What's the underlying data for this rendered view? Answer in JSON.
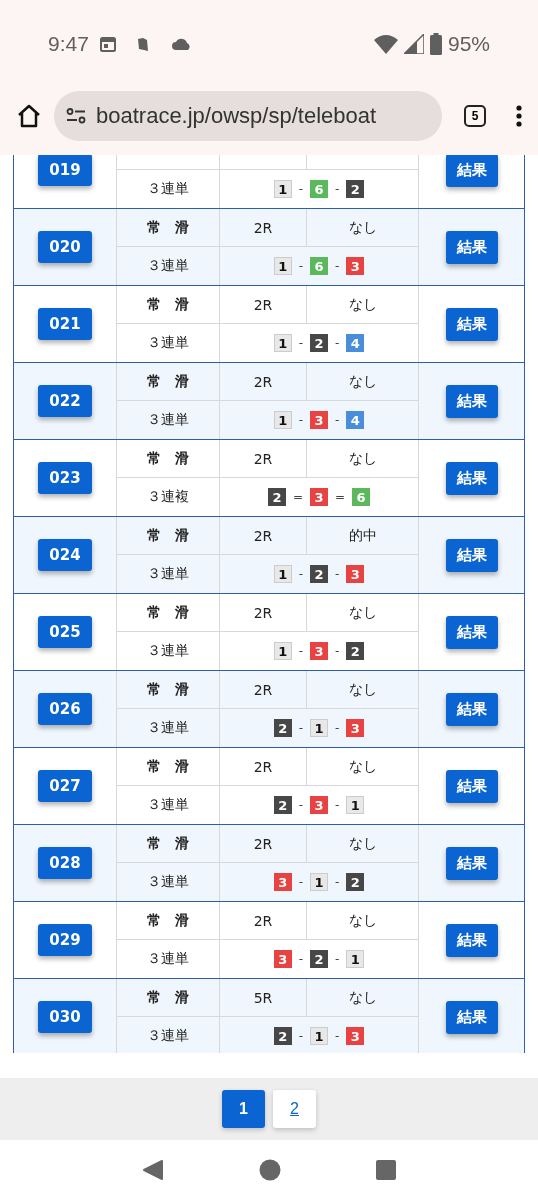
{
  "status_bar": {
    "time": "9:47",
    "battery": "95%"
  },
  "browser": {
    "url": "boatrace.jp/owsp/sp/teleboat",
    "tab_count": "5"
  },
  "rows": [
    {
      "id": "019",
      "bet_type": "３連単",
      "boats": [
        {
          "number": "1",
          "color": "#e8e8e8"
        },
        {
          "number": "6",
          "color": "#5cb85c"
        },
        {
          "number": "2",
          "color": "#474747"
        }
      ],
      "separator": "-",
      "button": "結果"
    },
    {
      "id": "020",
      "method": "常　滑",
      "race": "2R",
      "hit": "なし",
      "bet_type": "３連単",
      "boats": [
        {
          "number": "1",
          "color": "#e8e8e8"
        },
        {
          "number": "6",
          "color": "#5cb85c"
        },
        {
          "number": "3",
          "color": "#e84343"
        }
      ],
      "separator": "-",
      "button": "結果"
    },
    {
      "id": "021",
      "method": "常　滑",
      "race": "2R",
      "hit": "なし",
      "bet_type": "３連単",
      "boats": [
        {
          "number": "1",
          "color": "#e8e8e8"
        },
        {
          "number": "2",
          "color": "#474747"
        },
        {
          "number": "4",
          "color": "#4a8edb"
        }
      ],
      "separator": "-",
      "button": "結果"
    },
    {
      "id": "022",
      "method": "常　滑",
      "race": "2R",
      "hit": "なし",
      "bet_type": "３連単",
      "boats": [
        {
          "number": "1",
          "color": "#e8e8e8"
        },
        {
          "number": "3",
          "color": "#e84343"
        },
        {
          "number": "4",
          "color": "#4a8edb"
        }
      ],
      "separator": "-",
      "button": "結果"
    },
    {
      "id": "023",
      "method": "常　滑",
      "race": "2R",
      "hit": "なし",
      "bet_type": "３連複",
      "boats": [
        {
          "number": "2",
          "color": "#474747"
        },
        {
          "number": "3",
          "color": "#e84343"
        },
        {
          "number": "6",
          "color": "#5cb85c"
        }
      ],
      "separator": "=",
      "button": "結果"
    },
    {
      "id": "024",
      "method": "常　滑",
      "race": "2R",
      "hit": "的中",
      "bet_type": "３連単",
      "boats": [
        {
          "number": "1",
          "color": "#e8e8e8"
        },
        {
          "number": "2",
          "color": "#474747"
        },
        {
          "number": "3",
          "color": "#e84343"
        }
      ],
      "separator": "-",
      "button": "結果"
    },
    {
      "id": "025",
      "method": "常　滑",
      "race": "2R",
      "hit": "なし",
      "bet_type": "３連単",
      "boats": [
        {
          "number": "1",
          "color": "#e8e8e8"
        },
        {
          "number": "3",
          "color": "#e84343"
        },
        {
          "number": "2",
          "color": "#474747"
        }
      ],
      "separator": "-",
      "button": "結果"
    },
    {
      "id": "026",
      "method": "常　滑",
      "race": "2R",
      "hit": "なし",
      "bet_type": "３連単",
      "boats": [
        {
          "number": "2",
          "color": "#474747"
        },
        {
          "number": "1",
          "color": "#e8e8e8"
        },
        {
          "number": "3",
          "color": "#e84343"
        }
      ],
      "separator": "-",
      "button": "結果"
    },
    {
      "id": "027",
      "method": "常　滑",
      "race": "2R",
      "hit": "なし",
      "bet_type": "３連単",
      "boats": [
        {
          "number": "2",
          "color": "#474747"
        },
        {
          "number": "3",
          "color": "#e84343"
        },
        {
          "number": "1",
          "color": "#e8e8e8"
        }
      ],
      "separator": "-",
      "button": "結果"
    },
    {
      "id": "028",
      "method": "常　滑",
      "race": "2R",
      "hit": "なし",
      "bet_type": "３連単",
      "boats": [
        {
          "number": "3",
          "color": "#e84343"
        },
        {
          "number": "1",
          "color": "#e8e8e8"
        },
        {
          "number": "2",
          "color": "#474747"
        }
      ],
      "separator": "-",
      "button": "結果"
    },
    {
      "id": "029",
      "method": "常　滑",
      "race": "2R",
      "hit": "なし",
      "bet_type": "３連単",
      "boats": [
        {
          "number": "3",
          "color": "#e84343"
        },
        {
          "number": "2",
          "color": "#474747"
        },
        {
          "number": "1",
          "color": "#e8e8e8"
        }
      ],
      "separator": "-",
      "button": "結果"
    },
    {
      "id": "030",
      "method": "常　滑",
      "race": "5R",
      "hit": "なし",
      "bet_type": "３連単",
      "boats": [
        {
          "number": "2",
          "color": "#474747"
        },
        {
          "number": "1",
          "color": "#e8e8e8"
        },
        {
          "number": "3",
          "color": "#e84343"
        }
      ],
      "separator": "-",
      "button": "結果"
    }
  ],
  "pagination": [
    {
      "label": "1",
      "selected": true
    },
    {
      "label": "2",
      "selected": false
    }
  ]
}
